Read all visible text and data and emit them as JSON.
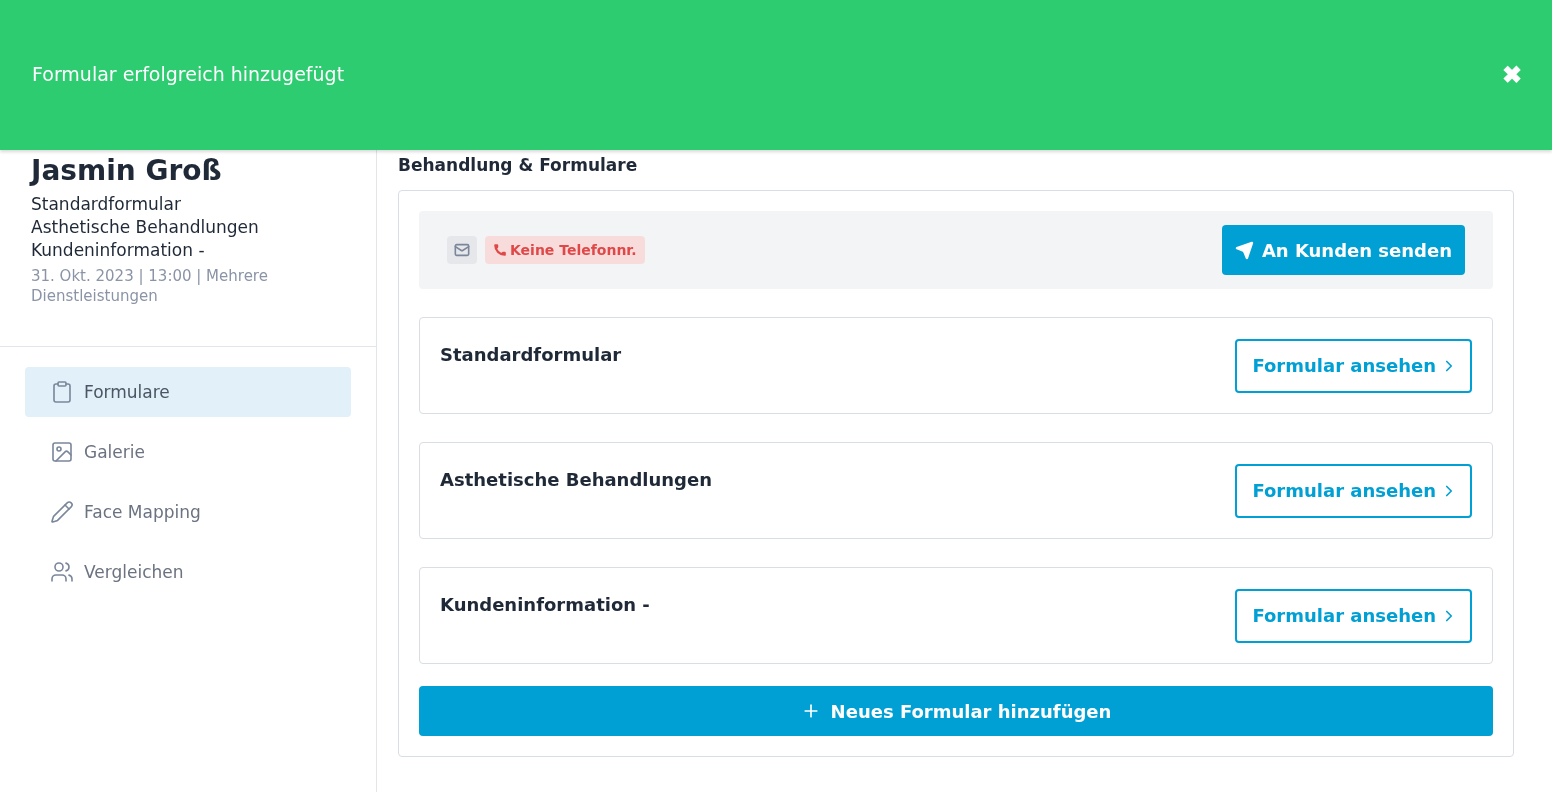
{
  "toast": {
    "message": "Formular erfolgreich hinzugefügt",
    "close": "✖"
  },
  "client": {
    "name": "Jasmin Groß",
    "forms": [
      "Standardformular",
      "Asthetische Behandlungen",
      "Kundeninformation -"
    ],
    "meta": "31. Okt. 2023 | 13:00 | Mehrere Dienstleistungen"
  },
  "sidebar": {
    "items": [
      {
        "label": "Formulare",
        "kind": "clipboard",
        "selected": true
      },
      {
        "label": "Galerie",
        "kind": "image",
        "selected": false
      },
      {
        "label": "Face Mapping",
        "kind": "pencil",
        "selected": false
      },
      {
        "label": "Vergleichen",
        "kind": "users",
        "selected": false
      }
    ]
  },
  "section_title": "Behandlung & Formulare",
  "contact": {
    "phone_badge": "Keine Telefonnr.",
    "send_button": "An Kunden senden"
  },
  "forms": [
    {
      "title": "Standardformular",
      "button": "Formular ansehen"
    },
    {
      "title": "Asthetische Behandlungen",
      "button": "Formular ansehen"
    },
    {
      "title": "Kundeninformation -",
      "button": "Formular ansehen"
    }
  ],
  "add_button": "Neues Formular hinzufügen"
}
